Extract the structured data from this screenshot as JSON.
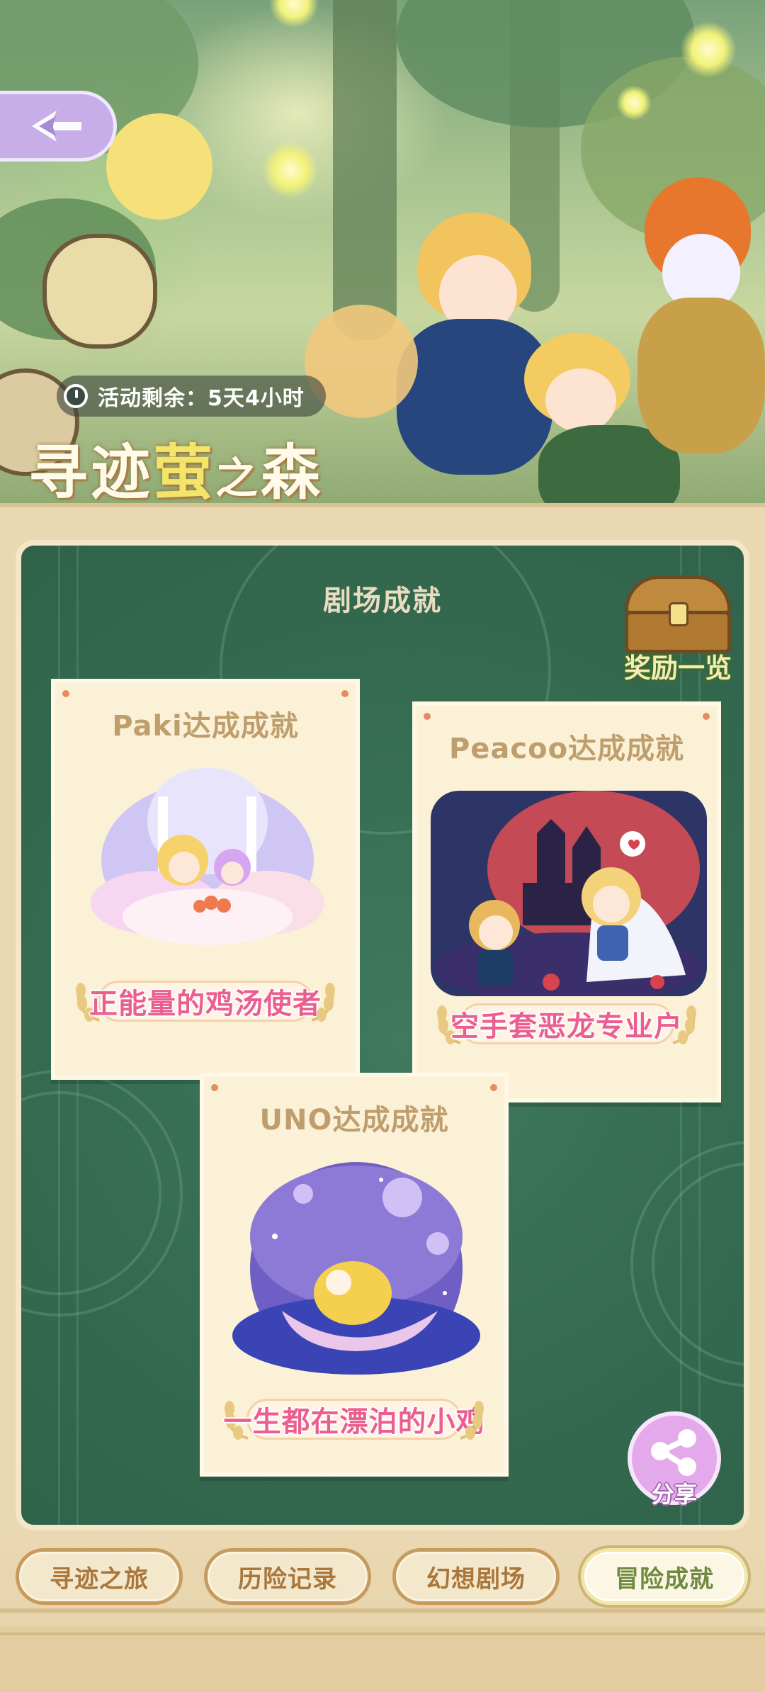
{
  "banner": {
    "timer_text": "活动剩余：5天4小时",
    "title_part1": "寻迹",
    "title_part2": "萤",
    "title_part3": "之",
    "title_part4": "森"
  },
  "board": {
    "title": "剧场成就",
    "reward_label": "奖励一览"
  },
  "cards": [
    {
      "title": "Paki达成成就",
      "badge": "正能量的鸡汤使者"
    },
    {
      "title": "Peacoo达成成就",
      "badge": "空手套恶龙专业户"
    },
    {
      "title": "UNO达成成就",
      "badge": "一生都在漂泊的小鸡"
    }
  ],
  "share": {
    "label": "分享"
  },
  "tabs": [
    {
      "label": "寻迹之旅",
      "active": false
    },
    {
      "label": "历险记录",
      "active": false
    },
    {
      "label": "幻想剧场",
      "active": false
    },
    {
      "label": "冒险成就",
      "active": true
    }
  ],
  "colors": {
    "board_green": "#346a50",
    "badge_pink": "#ea5f8f",
    "card_title": "#bf9e6e",
    "tab_text": "#a9763c",
    "share_purple": "#e4a9ea"
  }
}
